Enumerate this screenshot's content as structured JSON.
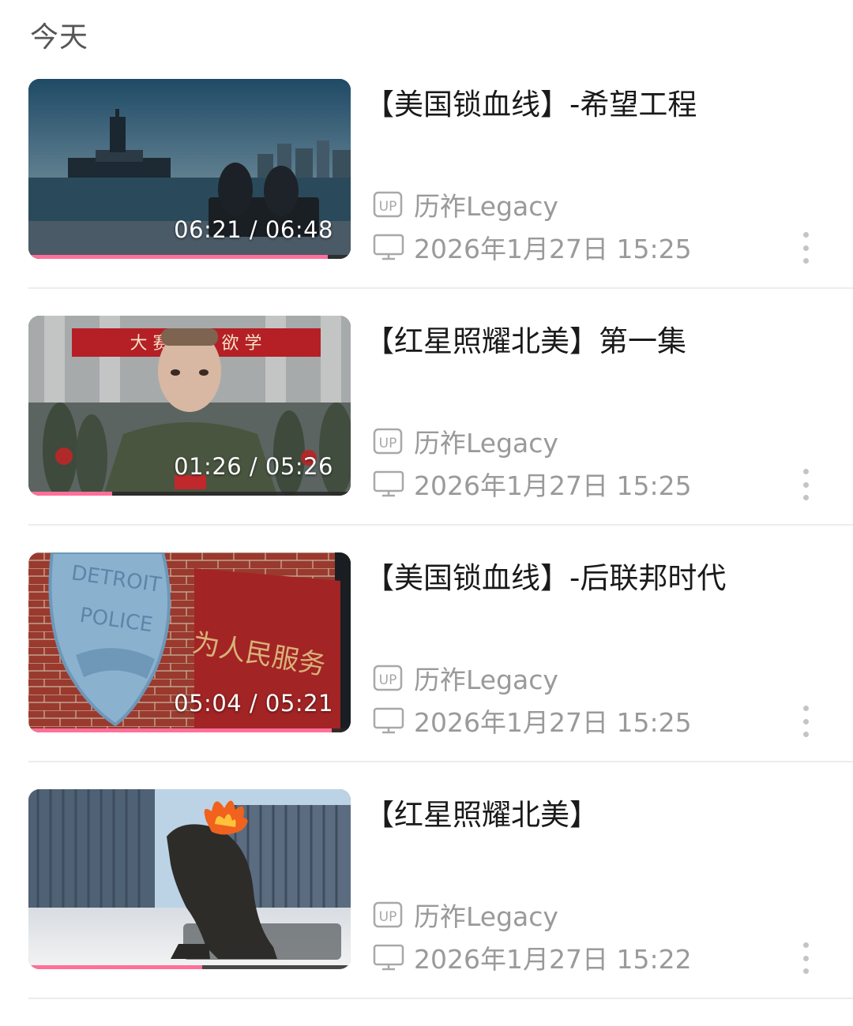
{
  "section": {
    "title": "今天"
  },
  "items": [
    {
      "title": "【美国锁血线】-希望工程",
      "author": "历祚Legacy",
      "time": "2026年1月27日 15:25",
      "duration": "06:21 / 06:48",
      "progress": 0.93
    },
    {
      "title": "【红星照耀北美】第一集",
      "author": "历祚Legacy",
      "time": "2026年1月27日 15:25",
      "duration": "01:26 / 05:26",
      "progress": 0.26
    },
    {
      "title": "【美国锁血线】-后联邦时代",
      "author": "历祚Legacy",
      "time": "2026年1月27日 15:25",
      "duration": "05:04 / 05:21",
      "progress": 0.94
    },
    {
      "title": "【红星照耀北美】",
      "author": "历祚Legacy",
      "time": "2026年1月27日 15:22",
      "duration": "",
      "progress": 0.54
    }
  ],
  "thumbnail_text": {
    "banner": "大 赛 … 进 欲 学",
    "badge_line1": "DETROIT",
    "badge_line2": "POLICE",
    "sign": "为人民服务"
  },
  "icons": {
    "up": "up-badge-icon",
    "device": "monitor-icon",
    "more": "more-vertical-icon"
  },
  "colors": {
    "progress": "#ff6f9a",
    "meta": "#9a9a9a"
  }
}
